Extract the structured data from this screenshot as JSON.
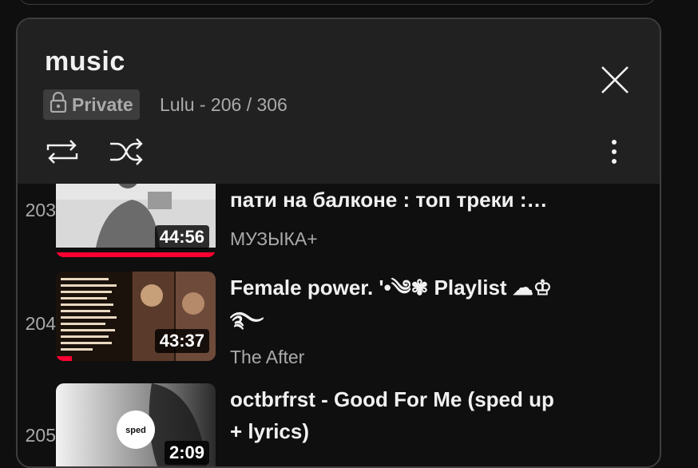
{
  "playlist": {
    "title": "music",
    "privacy": "Private",
    "meta": "Lulu - 206 / 306"
  },
  "icons": {
    "close": "close-icon",
    "loop": "loop-icon",
    "shuffle": "shuffle-icon",
    "more": "more-vert-icon",
    "lock": "lock-icon"
  },
  "colors": {
    "accent": "#ff0033",
    "header_bg": "#212121"
  },
  "items": [
    {
      "index": "203",
      "title": "пати на балконе : топ треки :…",
      "channel": "МУЗЫКА+",
      "duration": "44:56",
      "progress": 1.0
    },
    {
      "index": "204",
      "title": "Female power. '•༄✾ Playlist ☁♔",
      "title2": "࿐",
      "channel": "The After",
      "duration": "43:37",
      "progress": 0.1
    },
    {
      "index": "205",
      "title": "octbrfrst - Good For Me (sped up",
      "title2": "+ lyrics)",
      "channel": "",
      "duration": "2:09",
      "thumb_logo": "sped",
      "progress": 0
    }
  ]
}
